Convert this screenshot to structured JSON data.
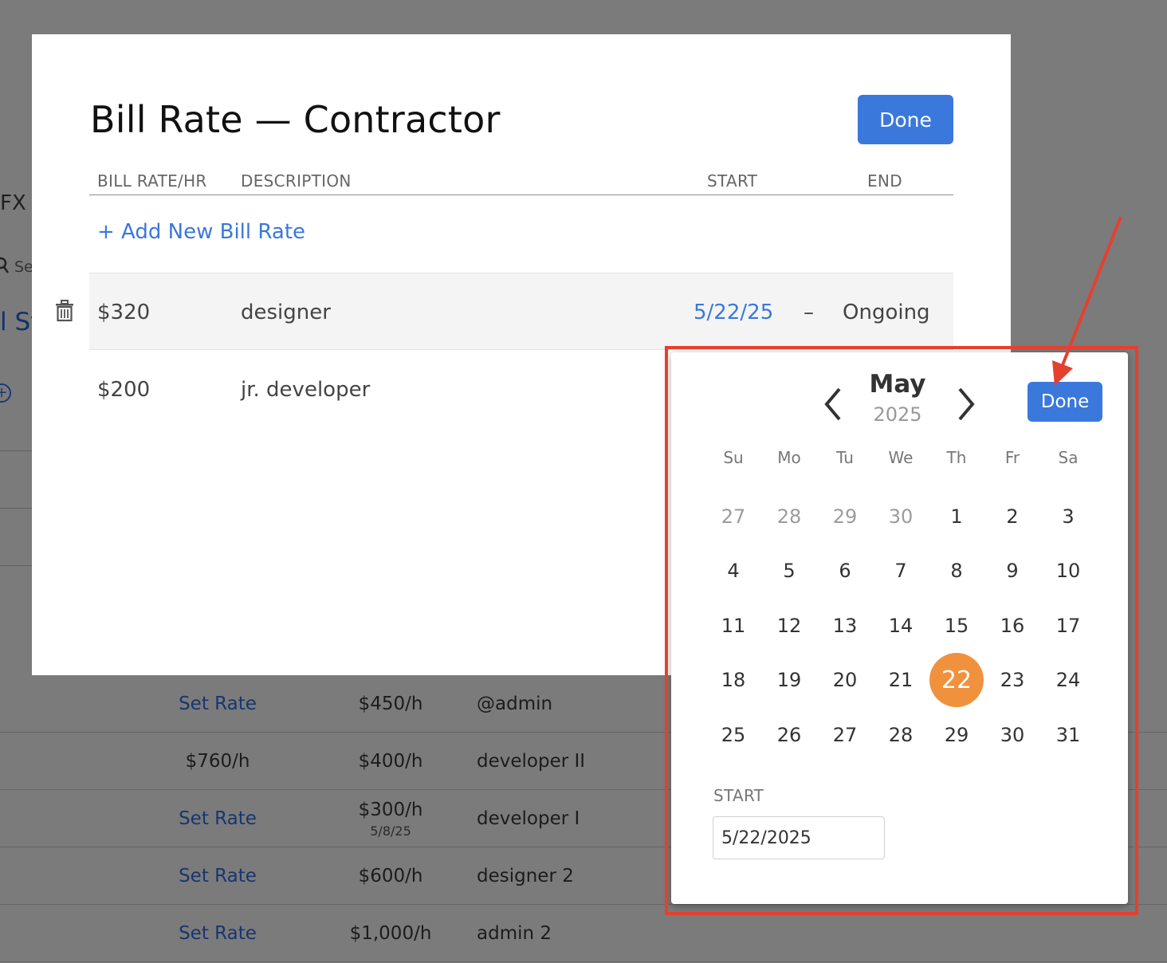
{
  "background": {
    "fragments": {
      "fx": "FX R",
      "search": "Se",
      "st": "l St",
      "plus": "+"
    },
    "rows": [
      {
        "rate": "Set Rate",
        "rate_is_link": true,
        "cost": "$450/h",
        "cost_sub": "",
        "desc": "@admin"
      },
      {
        "rate": "$760/h",
        "rate_is_link": false,
        "cost": "$400/h",
        "cost_sub": "",
        "desc": "developer II"
      },
      {
        "rate": "Set Rate",
        "rate_is_link": true,
        "cost": "$300/h",
        "cost_sub": "5/8/25",
        "desc": "developer I"
      },
      {
        "rate": "Set Rate",
        "rate_is_link": true,
        "cost": "$600/h",
        "cost_sub": "",
        "desc": "designer 2"
      },
      {
        "rate": "Set Rate",
        "rate_is_link": true,
        "cost": "$1,000/h",
        "cost_sub": "",
        "desc": "admin 2"
      }
    ]
  },
  "modal": {
    "title": "Bill Rate — Contractor",
    "done_label": "Done",
    "columns": {
      "rate": "BILL RATE/HR",
      "description": "DESCRIPTION",
      "start": "START",
      "end": "END"
    },
    "add_label": "+ Add New Bill Rate",
    "rows": [
      {
        "rate": "$320",
        "description": "designer",
        "start": "5/22/25",
        "dash": "–",
        "end": "Ongoing"
      },
      {
        "rate": "$200",
        "description": "jr. developer"
      }
    ]
  },
  "picker": {
    "month": "May",
    "year": "2025",
    "done_label": "Done",
    "weekdays": [
      "Su",
      "Mo",
      "Tu",
      "We",
      "Th",
      "Fr",
      "Sa"
    ],
    "weeks": [
      [
        "27",
        "28",
        "29",
        "30",
        "1",
        "2",
        "3"
      ],
      [
        "4",
        "5",
        "6",
        "7",
        "8",
        "9",
        "10"
      ],
      [
        "11",
        "12",
        "13",
        "14",
        "15",
        "16",
        "17"
      ],
      [
        "18",
        "19",
        "20",
        "21",
        "22",
        "23",
        "24"
      ],
      [
        "25",
        "26",
        "27",
        "28",
        "29",
        "30",
        "31"
      ]
    ],
    "muted_count_first_week": 4,
    "selected_day": "22",
    "start_label": "START",
    "start_value": "5/22/2025"
  },
  "colors": {
    "accent": "#3a78dc",
    "selected_day": "#f0913d",
    "annotation": "#e5402f",
    "overlay": "#7b7b7b"
  },
  "icons": {
    "trash": "trash-icon",
    "prev": "chevron-left-icon",
    "next": "chevron-right-icon",
    "search": "search-icon",
    "add": "plus-circle-icon"
  }
}
